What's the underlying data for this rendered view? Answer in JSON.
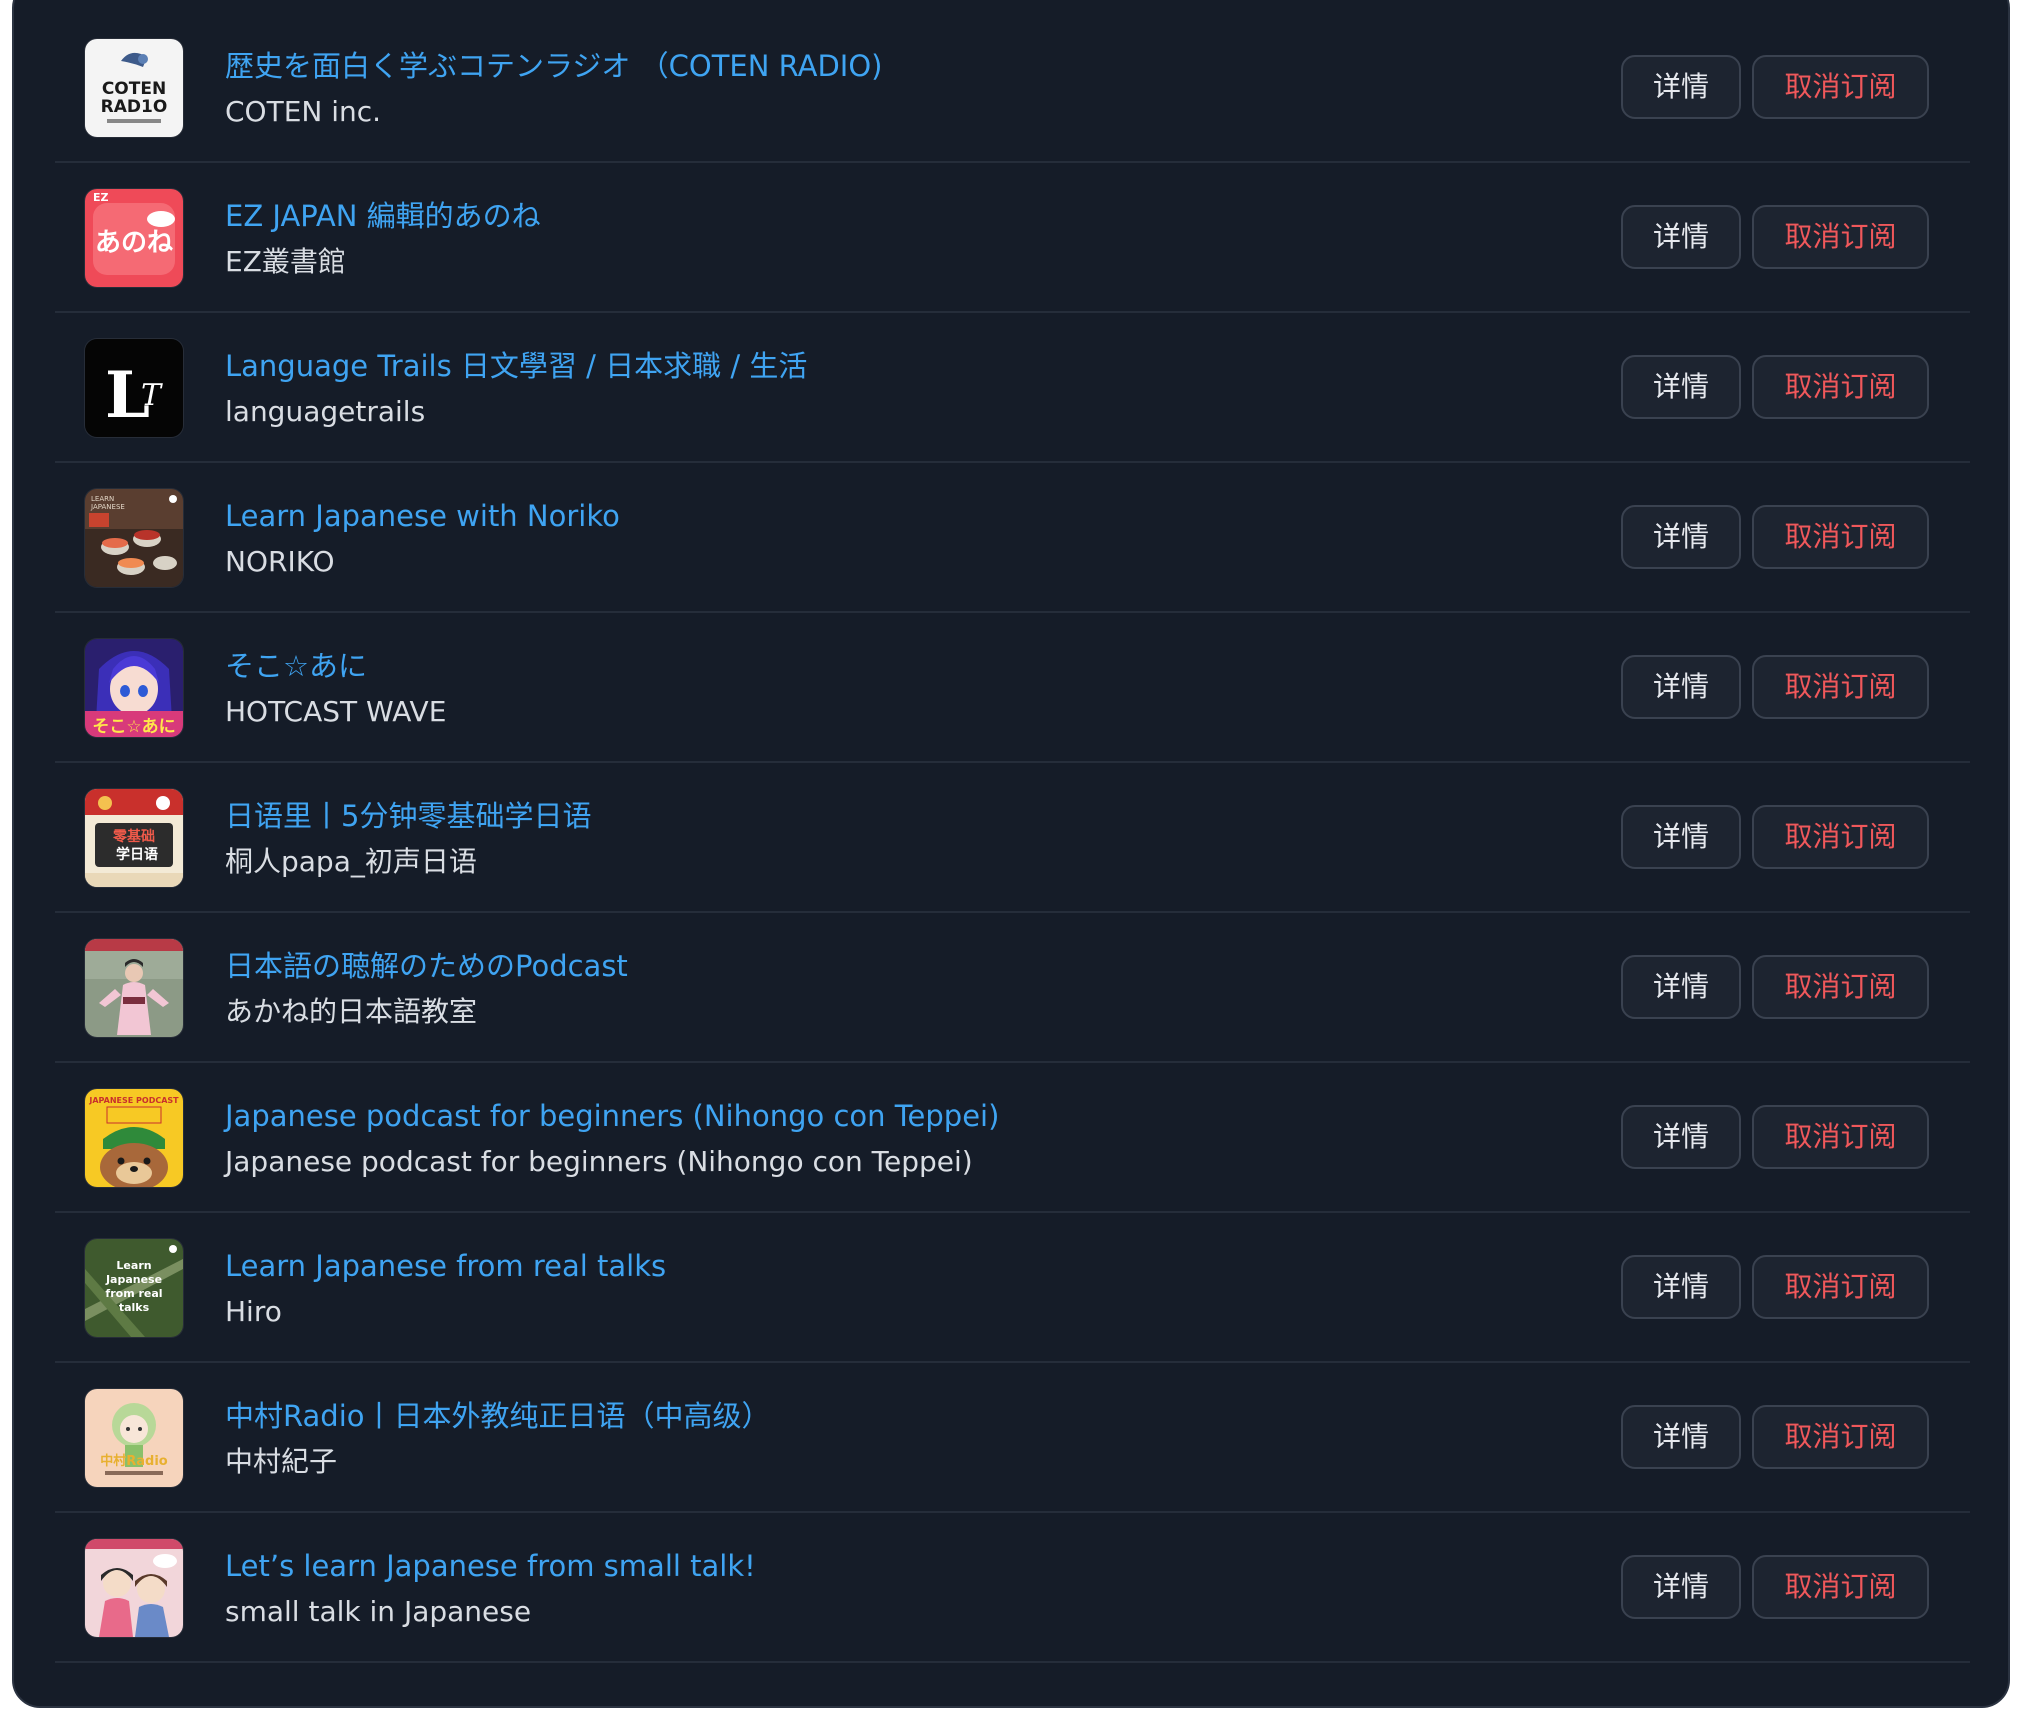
{
  "podcasts": [
    {
      "title": "歴史を面白く学ぶコテンラジオ （COTEN RADIO)",
      "author": "COTEN inc.",
      "cover": "coten-radio-cover",
      "cover_text": [
        "COTEN",
        "RAD1O"
      ]
    },
    {
      "title": "EZ JAPAN 編輯的あのね",
      "author": "EZ叢書館",
      "cover": "ez-japan-cover",
      "cover_text": [
        "EZ",
        "あのね"
      ]
    },
    {
      "title": "Language Trails 日文學習 / 日本求職 / 生活",
      "author": "languagetrails",
      "cover": "language-trails-cover",
      "cover_text": [
        "L",
        "T"
      ]
    },
    {
      "title": "Learn Japanese with Noriko",
      "author": "NORIKO",
      "cover": "noriko-sushi-cover",
      "cover_text": [
        "LEARN",
        "JAPANESE"
      ]
    },
    {
      "title": "そこ☆あに",
      "author": "HOTCAST WAVE",
      "cover": "soko-ani-anime-cover",
      "cover_text": [
        "そこ☆あに"
      ]
    },
    {
      "title": "日语里丨5分钟零基础学日语",
      "author": "桐人papa_初声日语",
      "cover": "riyuli-cover",
      "cover_text": [
        "零基础",
        "学日语"
      ]
    },
    {
      "title": "日本語の聴解のためのPodcast",
      "author": "あかね的日本語教室",
      "cover": "akane-kimono-cover",
      "cover_text": []
    },
    {
      "title": "Japanese podcast for beginners (Nihongo con Teppei)",
      "author": "Japanese podcast for beginners (Nihongo con Teppei)",
      "cover": "teppei-otter-cover",
      "cover_text": [
        "JAPANESE PODCAST"
      ]
    },
    {
      "title": "Learn Japanese from real talks",
      "author": "Hiro",
      "cover": "real-talks-cover",
      "cover_text": [
        "Learn",
        "Japanese",
        "from real",
        "talks"
      ]
    },
    {
      "title": "中村Radio丨日本外教纯正日语（中高级）",
      "author": "中村紀子",
      "cover": "nakamura-radio-cover",
      "cover_text": [
        "中村Radio"
      ]
    },
    {
      "title": "Let’s learn Japanese from small talk!",
      "author": "small talk in Japanese",
      "cover": "small-talk-cover",
      "cover_text": []
    }
  ],
  "buttons": {
    "detail": "详情",
    "unsubscribe": "取消订阅"
  },
  "colors": {
    "background": "#151c28",
    "title": "#3fa4f2",
    "author": "#d9dde3",
    "unsubscribe": "#f0585b",
    "button_bg": "#1d2430",
    "divider": "#252d3a"
  }
}
